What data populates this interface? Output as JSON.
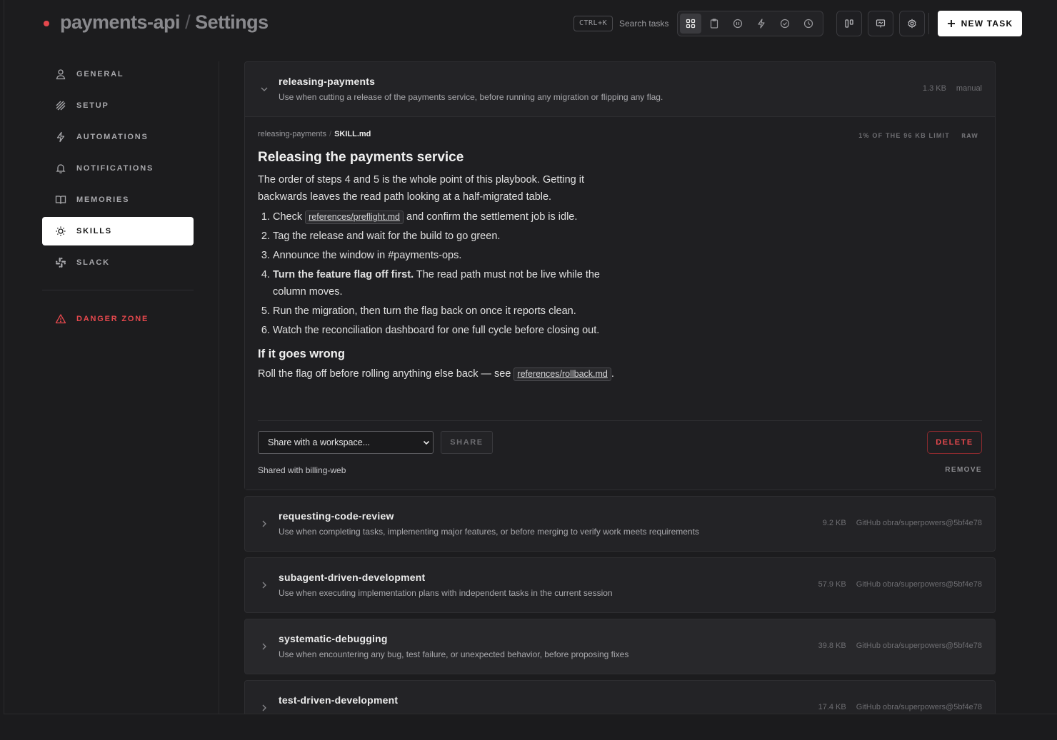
{
  "header": {
    "project": "payments-api",
    "separator": "/",
    "page": "Settings",
    "shortcut": "CTRL+K",
    "search_label": "Search tasks",
    "new_task_label": "NEW TASK"
  },
  "sidebar": {
    "items": [
      {
        "label": "GENERAL",
        "icon": "user-icon"
      },
      {
        "label": "SETUP",
        "icon": "setup-icon"
      },
      {
        "label": "AUTOMATIONS",
        "icon": "bolt-icon"
      },
      {
        "label": "NOTIFICATIONS",
        "icon": "bell-icon"
      },
      {
        "label": "MEMORIES",
        "icon": "book-icon"
      },
      {
        "label": "SKILLS",
        "icon": "lightbulb-icon",
        "active": true
      },
      {
        "label": "SLACK",
        "icon": "slack-icon"
      }
    ],
    "danger_label": "DANGER ZONE"
  },
  "skills": [
    {
      "name": "releasing-payments",
      "description": "Use when cutting a release of the payments service, before running any migration or flipping any flag.",
      "size": "1.3 KB",
      "source": "manual",
      "expanded": true
    },
    {
      "name": "requesting-code-review",
      "description": "Use when completing tasks, implementing major features, or before merging to verify work meets requirements",
      "size": "9.2 KB",
      "source": "GitHub obra/superpowers@5bf4e78"
    },
    {
      "name": "subagent-driven-development",
      "description": "Use when executing implementation plans with independent tasks in the current session",
      "size": "57.9 KB",
      "source": "GitHub obra/superpowers@5bf4e78"
    },
    {
      "name": "systematic-debugging",
      "description": "Use when encountering any bug, test failure, or unexpected behavior, before proposing fixes",
      "size": "39.8 KB",
      "source": "GitHub obra/superpowers@5bf4e78"
    },
    {
      "name": "test-driven-development",
      "description": "",
      "size": "17.4 KB",
      "source": "GitHub obra/superpowers@5bf4e78"
    }
  ],
  "detail": {
    "crumb_dir": "releasing-payments",
    "crumb_sep": "/",
    "crumb_file": "SKILL.md",
    "limit": "1% OF THE 96 KB LIMIT",
    "raw_label": "RAW",
    "heading": "Releasing the payments service",
    "intro": "The order of steps 4 and 5 is the whole point of this playbook. Getting it backwards leaves the read path looking at a half-migrated table.",
    "step1_pre": "Check ",
    "step1_link": "references/preflight.md",
    "step1_post": " and confirm the settlement job is idle.",
    "step2": "Tag the release and wait for the build to go green.",
    "step3": "Announce the window in #payments-ops.",
    "step4_bold": "Turn the feature flag off first.",
    "step4_rest": " The read path must not be live while the column moves.",
    "step5": "Run the migration, then turn the flag back on once it reports clean.",
    "step6": "Watch the reconciliation dashboard for one full cycle before closing out.",
    "subheading": "If it goes wrong",
    "rollback_text": "Roll the flag off before rolling anything else back — see ",
    "rollback_link": "references/rollback.md",
    "rollback_end": ".",
    "share_placeholder": "Share with a workspace...",
    "share_label": "SHARE",
    "delete_label": "DELETE",
    "shared_with": "Shared with billing-web",
    "remove_label": "REMOVE"
  },
  "colors": {
    "accent_danger": "#e5484d",
    "background": "#1c1c1e",
    "card": "#232326"
  }
}
